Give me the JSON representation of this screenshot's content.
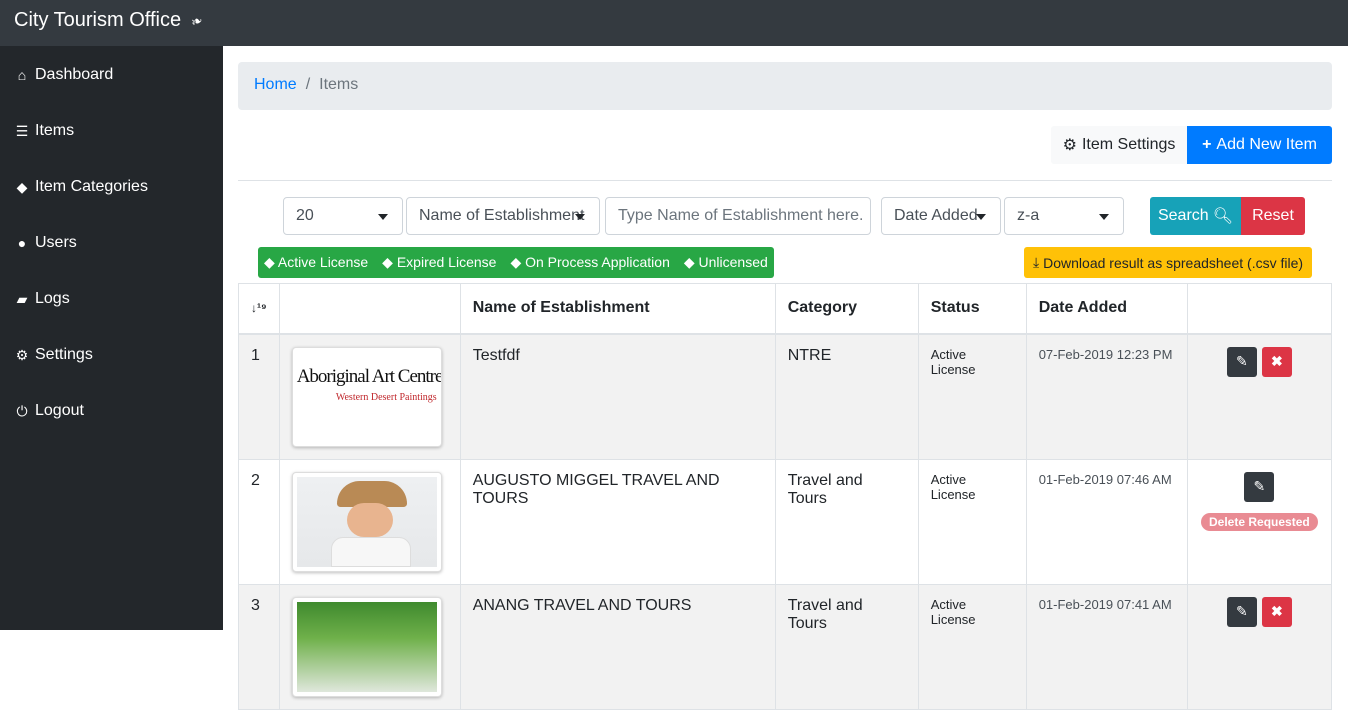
{
  "app": {
    "title": "City Tourism Office",
    "brand_icon": "leaf-icon"
  },
  "sidebar": {
    "items": [
      {
        "label": "Dashboard",
        "icon": "home-icon"
      },
      {
        "label": "Items",
        "icon": "list-icon"
      },
      {
        "label": "Item Categories",
        "icon": "tag-icon"
      },
      {
        "label": "Users",
        "icon": "users-icon"
      },
      {
        "label": "Logs",
        "icon": "book-icon"
      },
      {
        "label": "Settings",
        "icon": "gear-icon"
      },
      {
        "label": "Logout",
        "icon": "power-icon"
      }
    ]
  },
  "breadcrumb": {
    "home": "Home",
    "separator": "/",
    "current": "Items"
  },
  "toolbar": {
    "settings_label": "Item Settings",
    "add_label": "Add New Item"
  },
  "filters": {
    "per_page": "20",
    "field": "Name of Establishment",
    "search_placeholder": "Type Name of Establishment here.",
    "sort_field": "Date Added",
    "order": "z-a",
    "search_label": "Search",
    "reset_label": "Reset"
  },
  "legend": [
    "Active License",
    "Expired License",
    "On Process Application",
    "Unlicensed"
  ],
  "download_label": "Download result as spreadsheet (.csv file)",
  "table": {
    "sort_icon": "sort-numeric-icon",
    "headers": [
      "",
      "",
      "Name of Establishment",
      "Category",
      "Status",
      "Date Added",
      ""
    ],
    "rows": [
      {
        "num": "1",
        "name": "Testfdf",
        "category": "NTRE",
        "status": "Active License",
        "date": "07-Feb-2019 12:23 PM",
        "thumb_text": "Aboriginal Art Centre",
        "thumb_sub": "Western Desert Paintings",
        "badge": ""
      },
      {
        "num": "2",
        "name": "AUGUSTO MIGGEL TRAVEL AND TOURS",
        "category": "Travel and Tours",
        "status": "Active License",
        "date": "01-Feb-2019 07:46 AM",
        "thumb_text": "",
        "thumb_sub": "",
        "badge": "Delete Requested"
      },
      {
        "num": "3",
        "name": "ANANG TRAVEL AND TOURS",
        "category": "Travel and Tours",
        "status": "Active License",
        "date": "01-Feb-2019 07:41 AM",
        "thumb_text": "",
        "thumb_sub": "",
        "badge": ""
      }
    ]
  },
  "colors": {
    "primary": "#007bff",
    "info": "#17a2b8",
    "danger": "#dc3545",
    "success": "#28a745",
    "warning": "#ffc107",
    "dark": "#343a40"
  }
}
